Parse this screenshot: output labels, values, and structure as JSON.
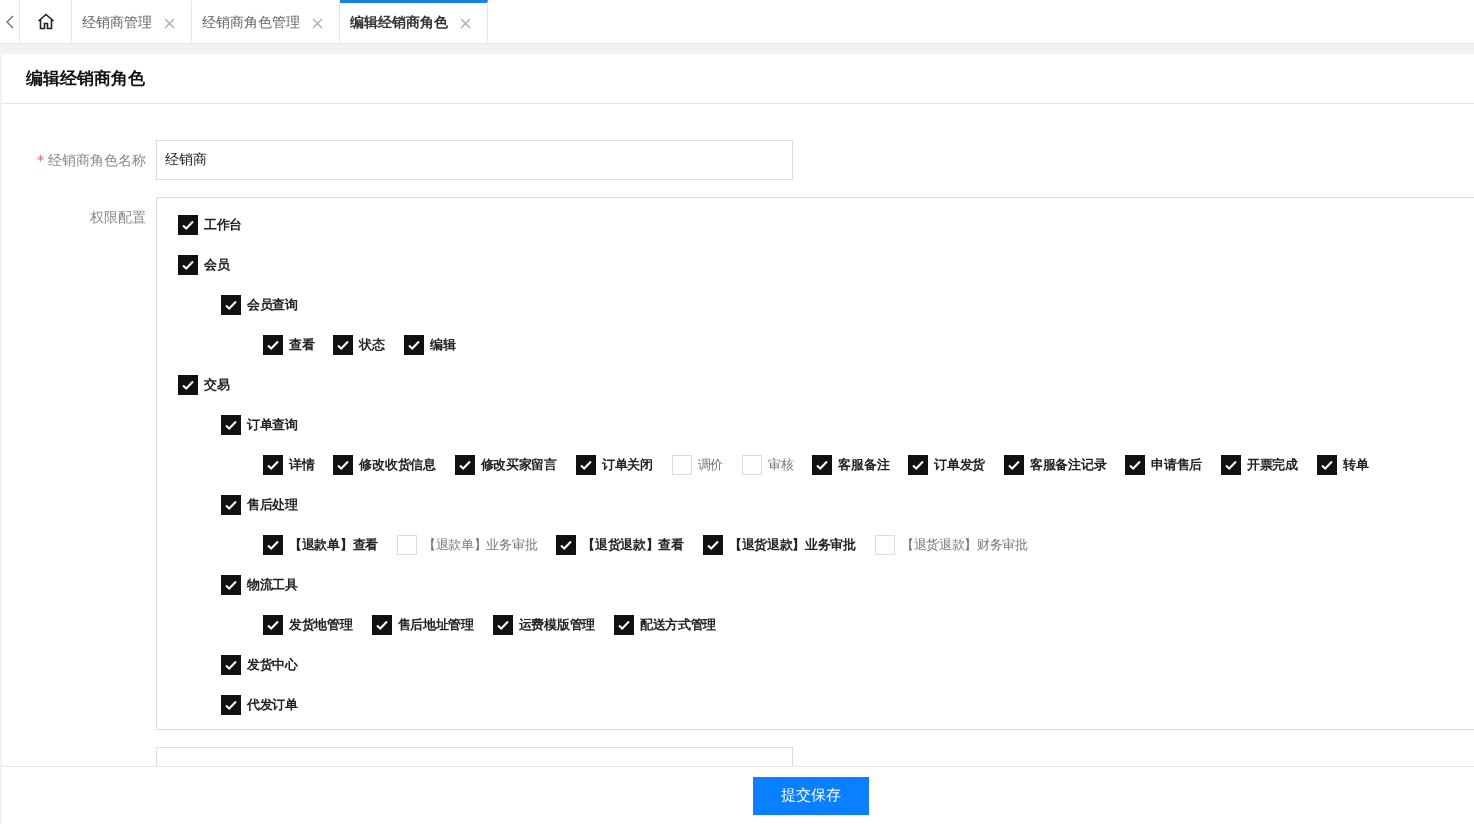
{
  "tabs": [
    {
      "label": "经销商管理",
      "selected": false
    },
    {
      "label": "经销商角色管理",
      "selected": false
    },
    {
      "label": "编辑经销商角色",
      "selected": true
    }
  ],
  "page_title": "编辑经销商角色",
  "form": {
    "name_field": {
      "label": "经销商角色名称",
      "required_mark": "*",
      "value": "经销商"
    },
    "permissions": {
      "label": "权限配置",
      "tree": [
        {
          "label": "工作台",
          "checked": true
        },
        {
          "label": "会员",
          "checked": true,
          "children": [
            {
              "label": "会员查询",
              "checked": true,
              "children": [
                {
                  "label": "查看",
                  "checked": true
                },
                {
                  "label": "状态",
                  "checked": true
                },
                {
                  "label": "编辑",
                  "checked": true
                }
              ]
            }
          ]
        },
        {
          "label": "交易",
          "checked": true,
          "children": [
            {
              "label": "订单查询",
              "checked": true,
              "children": [
                {
                  "label": "详情",
                  "checked": true
                },
                {
                  "label": "修改收货信息",
                  "checked": true
                },
                {
                  "label": "修改买家留言",
                  "checked": true
                },
                {
                  "label": "订单关闭",
                  "checked": true
                },
                {
                  "label": "调价",
                  "checked": false
                },
                {
                  "label": "审核",
                  "checked": false
                },
                {
                  "label": "客服备注",
                  "checked": true
                },
                {
                  "label": "订单发货",
                  "checked": true
                },
                {
                  "label": "客服备注记录",
                  "checked": true
                },
                {
                  "label": "申请售后",
                  "checked": true
                },
                {
                  "label": "开票完成",
                  "checked": true
                },
                {
                  "label": "转单",
                  "checked": true
                }
              ]
            },
            {
              "label": "售后处理",
              "checked": true,
              "children": [
                {
                  "label": "【退款单】查看",
                  "checked": true
                },
                {
                  "label": "【退款单】业务审批",
                  "checked": false
                },
                {
                  "label": "【退货退款】查看",
                  "checked": true
                },
                {
                  "label": "【退货退款】业务审批",
                  "checked": true
                },
                {
                  "label": "【退货退款】财务审批",
                  "checked": false
                }
              ]
            },
            {
              "label": "物流工具",
              "checked": true,
              "children": [
                {
                  "label": "发货地管理",
                  "checked": true
                },
                {
                  "label": "售后地址管理",
                  "checked": true
                },
                {
                  "label": "运费模版管理",
                  "checked": true
                },
                {
                  "label": "配送方式管理",
                  "checked": true
                }
              ]
            },
            {
              "label": "发货中心",
              "checked": true
            },
            {
              "label": "代发订单",
              "checked": true
            }
          ]
        }
      ]
    }
  },
  "submit_button": "提交保存"
}
